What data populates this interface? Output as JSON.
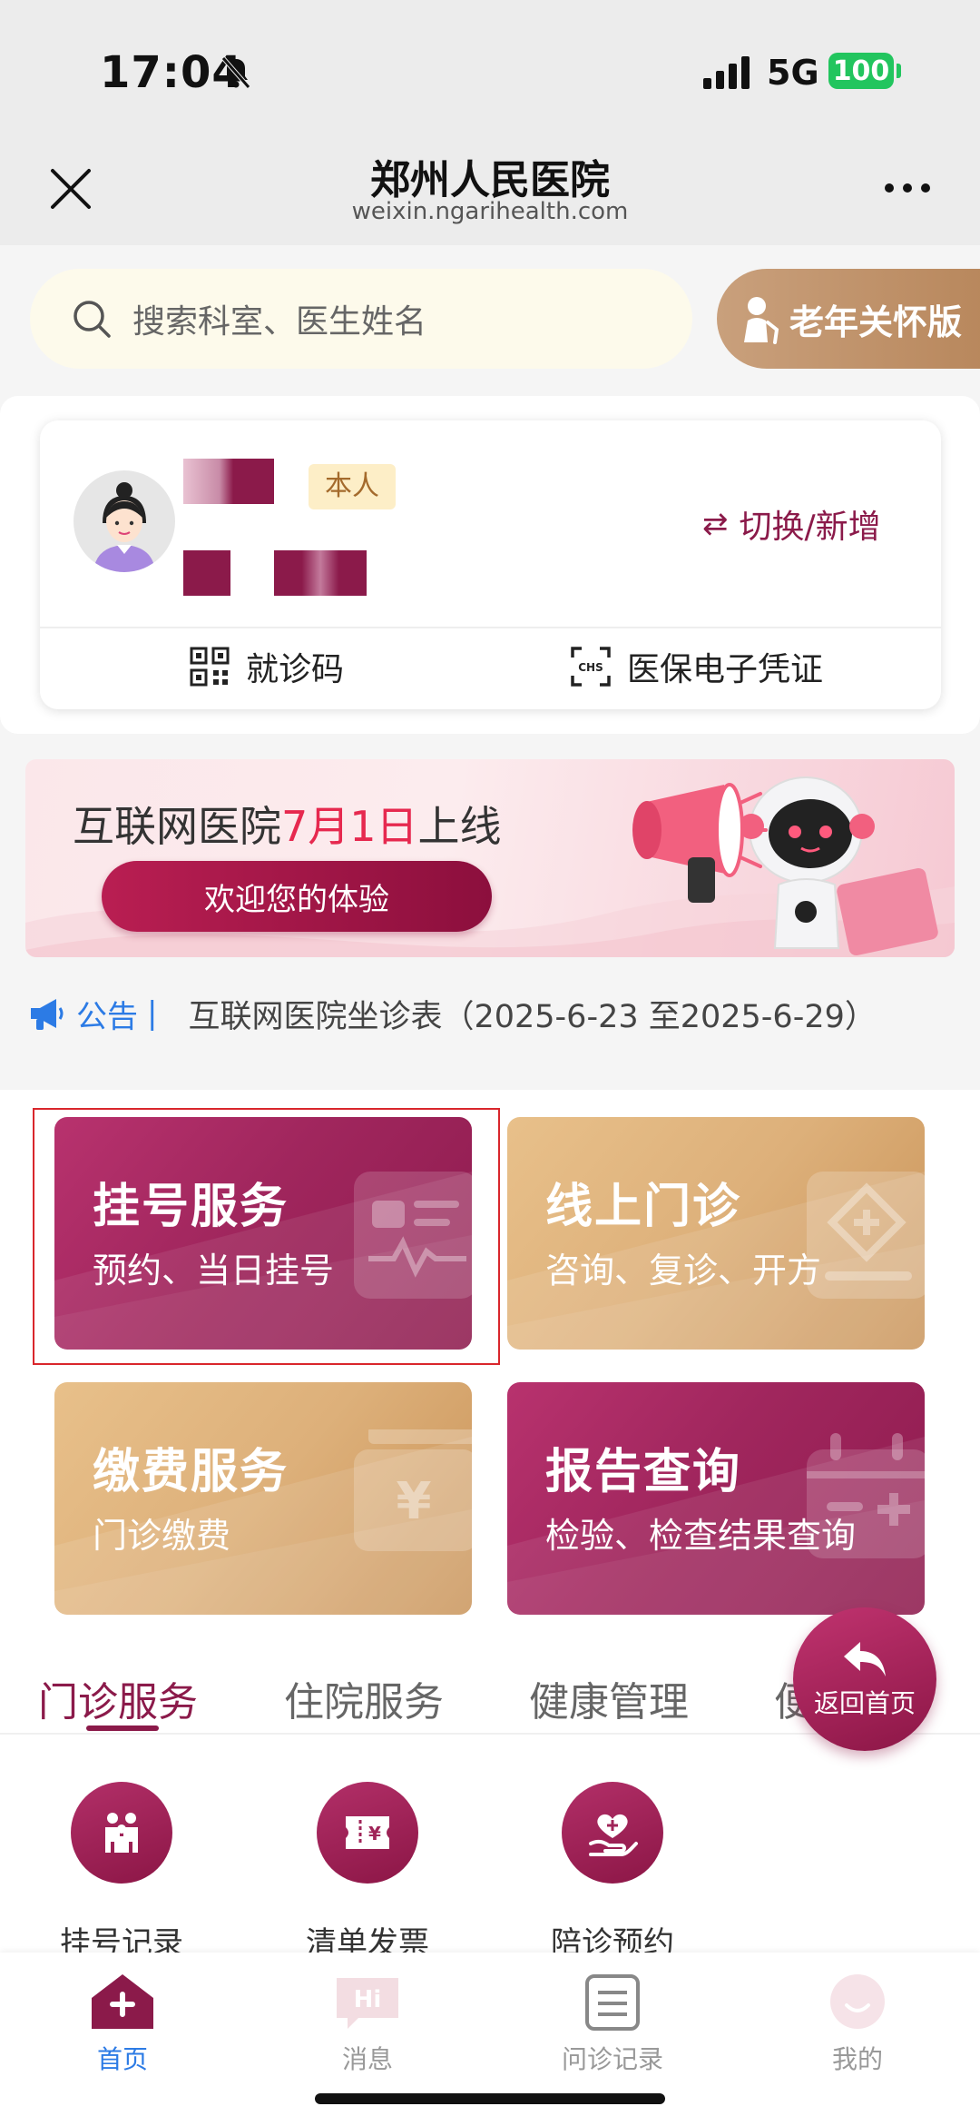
{
  "status_bar": {
    "time": "17:04",
    "network": "5G",
    "battery": "100"
  },
  "nav": {
    "title": "郑州人民医院",
    "subtitle": "weixin.ngarihealth.com"
  },
  "search": {
    "placeholder": "搜索科室、医生姓名"
  },
  "elder_mode": {
    "label": "老年关怀版"
  },
  "user_card": {
    "badge": "本人",
    "switch_label": "切换/新增",
    "actions": [
      {
        "label": "就诊码",
        "icon": "qr-code-icon"
      },
      {
        "label": "医保电子凭证",
        "icon": "chs-scan-icon"
      }
    ]
  },
  "banner": {
    "title_prefix": "互联网医院",
    "title_highlight": "7月1日",
    "title_suffix": "上线",
    "button": "欢迎您的体验"
  },
  "notice": {
    "label": "公告",
    "separator": "|",
    "text": "互联网医院坐诊表（2025-6-23 至2025-6-29）"
  },
  "services": [
    {
      "title": "挂号服务",
      "subtitle": "预约、当日挂号",
      "theme": "red",
      "icon": "registration-card-icon"
    },
    {
      "title": "线上门诊",
      "subtitle": "咨询、复诊、开方",
      "theme": "gold",
      "icon": "online-clinic-icon"
    },
    {
      "title": "缴费服务",
      "subtitle": "门诊缴费",
      "theme": "gold",
      "icon": "payment-wallet-icon"
    },
    {
      "title": "报告查询",
      "subtitle": "检验、检查结果查询",
      "theme": "red",
      "icon": "report-calendar-icon"
    }
  ],
  "return_home": {
    "label": "返回首页"
  },
  "tabs": [
    {
      "label": "门诊服务",
      "active": true
    },
    {
      "label": "住院服务",
      "active": false
    },
    {
      "label": "健康管理",
      "active": false
    },
    {
      "label": "便民服务",
      "active": false
    }
  ],
  "sub_services": [
    {
      "label": "挂号记录",
      "icon": "family-icon"
    },
    {
      "label": "清单发票",
      "icon": "invoice-icon"
    },
    {
      "label": "陪诊预约",
      "icon": "care-hand-icon"
    }
  ],
  "bottom_nav": [
    {
      "label": "首页",
      "icon": "home-icon",
      "active": true
    },
    {
      "label": "消息",
      "icon": "message-icon",
      "active": false
    },
    {
      "label": "问诊记录",
      "icon": "records-icon",
      "active": false
    },
    {
      "label": "我的",
      "icon": "profile-icon",
      "active": false
    }
  ],
  "colors": {
    "brand": "#8b1a4a",
    "gold": "#ddb07a",
    "link": "#2c7be5",
    "highlight_border": "#d9262c"
  }
}
